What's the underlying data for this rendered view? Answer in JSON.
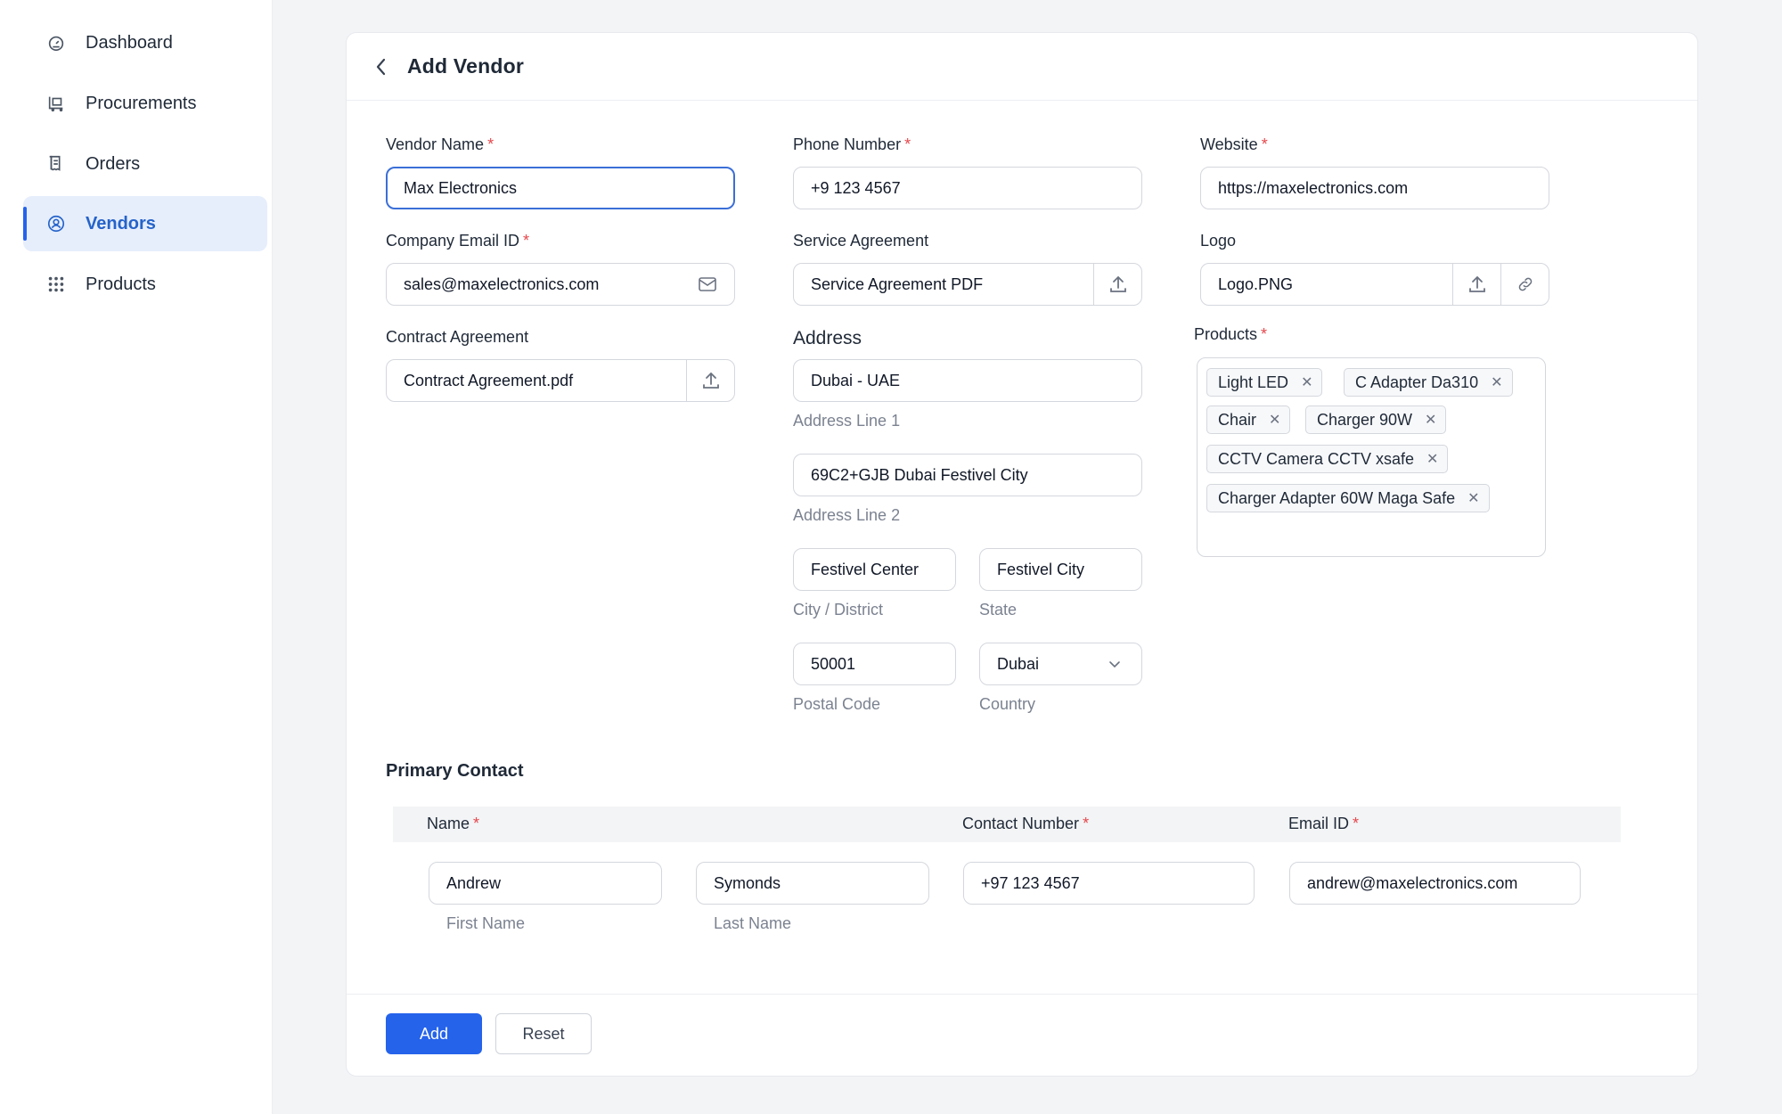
{
  "sidebar": {
    "items": [
      {
        "label": "Dashboard",
        "icon": "dashboard-icon"
      },
      {
        "label": "Procurements",
        "icon": "cart-icon"
      },
      {
        "label": "Orders",
        "icon": "receipt-icon"
      },
      {
        "label": "Vendors",
        "icon": "vendor-icon",
        "active": true
      },
      {
        "label": "Products",
        "icon": "grid-icon"
      }
    ]
  },
  "page": {
    "title": "Add Vendor"
  },
  "form": {
    "vendor_name": {
      "label": "Vendor Name",
      "value": "Max Electronics"
    },
    "phone_number": {
      "label": "Phone Number",
      "value": "+9 123 4567"
    },
    "website": {
      "label": "Website",
      "value": "https://maxelectronics.com"
    },
    "company_email": {
      "label": "Company Email ID",
      "value": "sales@maxelectronics.com"
    },
    "service_agreement": {
      "label": "Service Agreement",
      "value": "Service Agreement PDF"
    },
    "logo": {
      "label": "Logo",
      "value": "Logo.PNG"
    },
    "contract_agreement": {
      "label": "Contract Agreement",
      "value": "Contract Agreement.pdf"
    },
    "address": {
      "title": "Address",
      "line1": {
        "value": "Dubai - UAE",
        "caption": "Address Line 1"
      },
      "line2": {
        "value": "69C2+GJB Dubai Festivel City",
        "caption": "Address Line 2"
      },
      "city": {
        "value": "Festivel Center",
        "caption": "City / District"
      },
      "state": {
        "value": "Festivel City",
        "caption": "State"
      },
      "postal": {
        "value": "50001",
        "caption": "Postal Code"
      },
      "country": {
        "value": "Dubai",
        "caption": "Country"
      }
    },
    "products": {
      "label": "Products",
      "chips": [
        "Light LED",
        "C Adapter Da310",
        "Chair",
        "Charger 90W",
        "CCTV Camera CCTV xsafe",
        "Charger Adapter 60W Maga Safe"
      ]
    },
    "required_mark": "*"
  },
  "primary_contact": {
    "title": "Primary Contact",
    "headers": {
      "name": "Name",
      "contact_number": "Contact Number",
      "email": "Email ID"
    },
    "first_name": {
      "value": "Andrew",
      "caption": "First Name"
    },
    "last_name": {
      "value": "Symonds",
      "caption": "Last Name"
    },
    "contact_number": "+97 123 4567",
    "email": "andrew@maxelectronics.com"
  },
  "actions": {
    "add": "Add",
    "reset": "Reset"
  },
  "colors": {
    "accent": "#2563eb",
    "required": "#e5484d",
    "active_bg": "#e6eefc"
  }
}
